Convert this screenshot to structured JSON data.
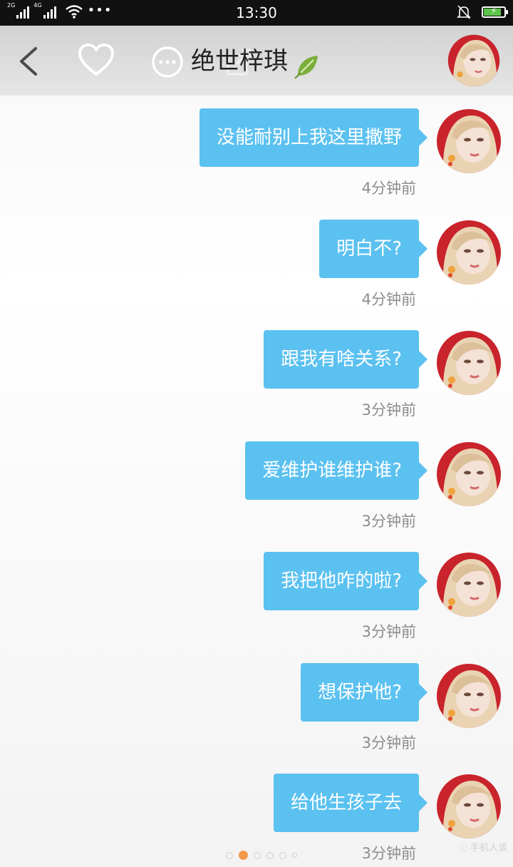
{
  "status_bar": {
    "network_1": "2G",
    "network_2": "4G",
    "more": "•••",
    "time": "13:30",
    "bell_icon": "bell-off-icon",
    "battery_icon": "battery-charging-icon",
    "battery_level": 0.8
  },
  "header": {
    "back_icon": "chevron-left-icon",
    "like_icon": "heart-icon",
    "more_icon": "more-dots-icon",
    "share_icon": "share-icon",
    "name": "绝世梓琪",
    "name_decoration_icon": "leaf-icon",
    "avatar_icon": "avatar"
  },
  "messages": [
    {
      "text": "没能耐别上我这里撒野",
      "time": "4分钟前"
    },
    {
      "text": "明白不?",
      "time": "4分钟前"
    },
    {
      "text": "跟我有啥关系?",
      "time": "3分钟前"
    },
    {
      "text": "爱维护谁维护谁?",
      "time": "3分钟前"
    },
    {
      "text": "我把他咋的啦?",
      "time": "3分钟前"
    },
    {
      "text": "想保护他?",
      "time": "3分钟前"
    },
    {
      "text": "给他生孩子去",
      "time": "3分钟前"
    }
  ],
  "pager": {
    "count": 6,
    "active_index": 1
  },
  "watermark": "ⓘ 手机人谈"
}
